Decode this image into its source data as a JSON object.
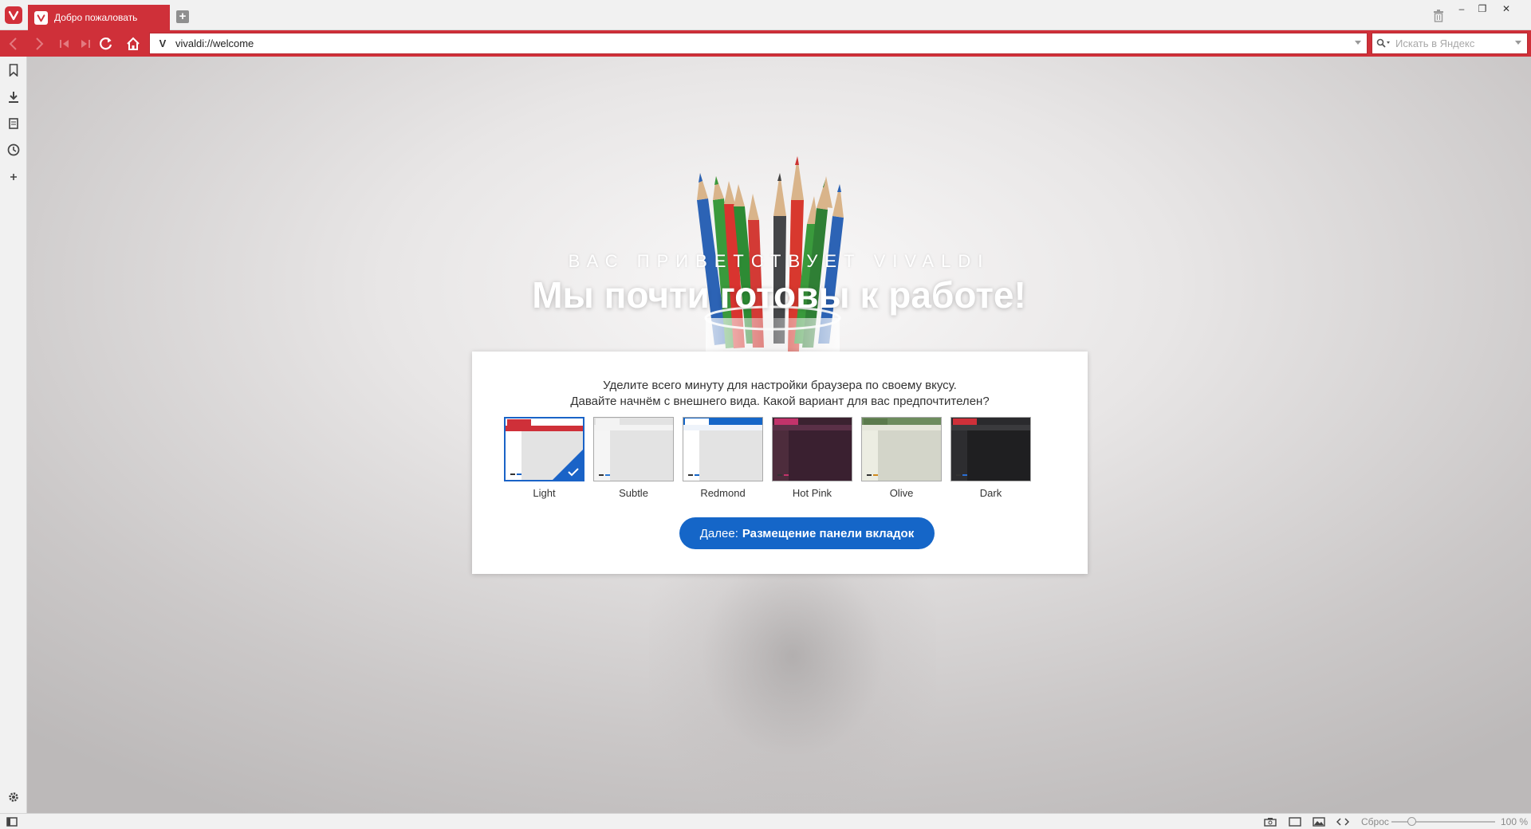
{
  "tab": {
    "title": "Добро пожаловать"
  },
  "window": {
    "minimize": "–",
    "restore": "❐",
    "close": "✕",
    "newtab": "+"
  },
  "address": {
    "url": "vivaldi://welcome",
    "search_placeholder": "Искать в Яндекс"
  },
  "welcome": {
    "kicker": "ВАС ПРИВЕТСТВУЕТ VIVALDI",
    "title": "Мы почти готовы к работе!",
    "line1": "Уделите всего минуту для настройки браузера по своему вкусу.",
    "line2": "Давайте начнём с внешнего вида. Какой вариант для вас предпочтителен?"
  },
  "themes": [
    {
      "label": "Light",
      "selected": true,
      "top": "#ffffff",
      "tab": "#cf3039",
      "addr": "#cf3039",
      "side": "#ffffff",
      "main": "#e3e3e3",
      "accent": "#1a63c7"
    },
    {
      "label": "Subtle",
      "selected": false,
      "top": "#e2e2e2",
      "tab": "#f3f3f3",
      "addr": "#f3f3f3",
      "side": "#f5f5f5",
      "main": "#e3e3e3",
      "accent": "#2c7ad6"
    },
    {
      "label": "Redmond",
      "selected": false,
      "top": "#1566c8",
      "tab": "#ffffff",
      "addr": "#eef3fa",
      "side": "#ffffff",
      "main": "#e3e3e3",
      "accent": "#1566c8"
    },
    {
      "label": "Hot Pink",
      "selected": false,
      "top": "#3b2230",
      "tab": "#c2336b",
      "addr": "#5a3047",
      "side": "#4d2c3c",
      "main": "#3a2030",
      "accent": "#c2336b"
    },
    {
      "label": "Olive",
      "selected": false,
      "top": "#6d8c5e",
      "tab": "#5b7a4c",
      "addr": "#e5e6da",
      "side": "#ecede2",
      "main": "#d3d5c9",
      "accent": "#d08a1e"
    },
    {
      "label": "Dark",
      "selected": false,
      "top": "#2a2a2d",
      "tab": "#cf3039",
      "addr": "#3a3a3d",
      "side": "#2d2d30",
      "main": "#1f1f21",
      "accent": "#2a6fd6"
    }
  ],
  "next_button": {
    "prefix": "Далее:",
    "label": "Размещение панели вкладок"
  },
  "status": {
    "reset": "Сброс",
    "zoom": "100 %"
  },
  "icons": {
    "back": "arrow-left-icon",
    "forward": "arrow-right-icon",
    "rewind": "rewind-icon",
    "fast_forward": "fast-forward-icon",
    "reload": "reload-icon",
    "home": "home-icon",
    "bookmarks": "bookmark-icon",
    "downloads": "download-icon",
    "notes": "notes-icon",
    "history": "history-icon",
    "add_panel": "plus-icon",
    "settings": "gear-icon",
    "trash": "trash-icon"
  },
  "colors": {
    "accent": "#cf3039",
    "button": "#1566c8"
  }
}
